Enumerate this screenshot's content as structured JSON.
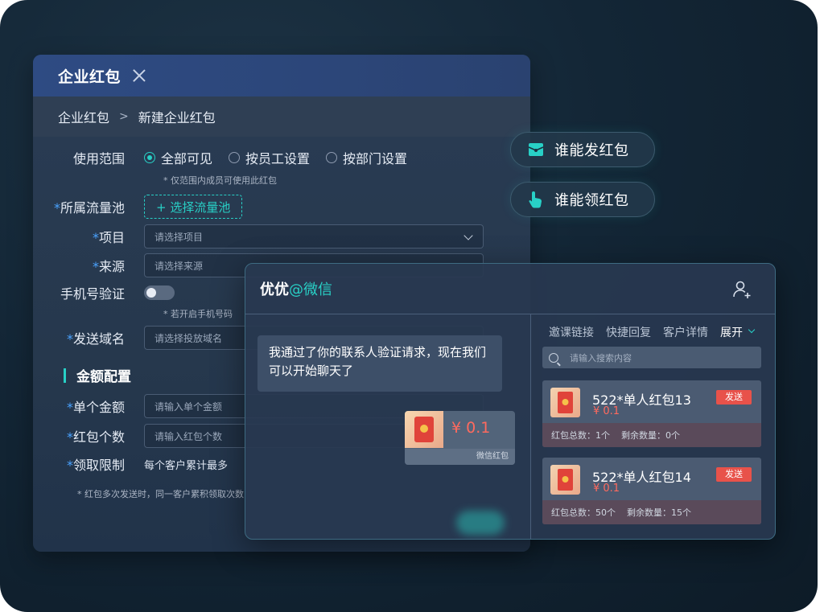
{
  "panel": {
    "title": "企业红包",
    "breadcrumb": {
      "parent": "企业红包",
      "current": "新建企业红包"
    }
  },
  "form": {
    "scope": {
      "label": "使用范围",
      "options": [
        "全部可见",
        "按员工设置",
        "按部门设置"
      ],
      "selected": "全部可见",
      "hint": "* 仅范围内成员可使用此红包"
    },
    "pool": {
      "label": "所属流量池",
      "button": "+ 选择流量池"
    },
    "project": {
      "label": "项目",
      "placeholder": "请选择项目"
    },
    "source": {
      "label": "来源",
      "placeholder": "请选择来源"
    },
    "phone": {
      "label": "手机号验证",
      "hint": "* 若开启手机号码"
    },
    "domain": {
      "label": "发送域名",
      "placeholder": "请选择投放域名"
    },
    "amount_section": "金额配置",
    "single_amount": {
      "label": "单个金额",
      "placeholder": "请输入单个金额"
    },
    "count": {
      "label": "红包个数",
      "placeholder": "请输入红包个数"
    },
    "limit": {
      "label": "领取限制",
      "text": "每个客户累计最多"
    },
    "footnote": "* 红包多次发送时，同一客户累积领取次数"
  },
  "pills": {
    "who_send": "谁能发红包",
    "who_receive": "谁能领红包"
  },
  "chat": {
    "name": "优优",
    "source": "@微信",
    "message": "我通过了你的联系人验证请求，现在我们可以开始聊天了",
    "redpacket": {
      "amount": "¥ 0.1",
      "footer": "微信红包"
    },
    "tabs": [
      "邀课链接",
      "快捷回复",
      "客户详情",
      "展开"
    ],
    "search_placeholder": "请输入搜索内容",
    "items": [
      {
        "title": "522*单人红包13",
        "amount": "¥ 0.1",
        "send": "发送",
        "total": "红包总数：1个",
        "remaining": "剩余数量：0个"
      },
      {
        "title": "522*单人红包14",
        "amount": "¥ 0.1",
        "send": "发送",
        "total": "红包总数：50个",
        "remaining": "剩余数量：15个"
      }
    ]
  },
  "colors": {
    "accent": "#28d0c6",
    "required": "#4aa3ff",
    "danger": "#e8524a"
  }
}
